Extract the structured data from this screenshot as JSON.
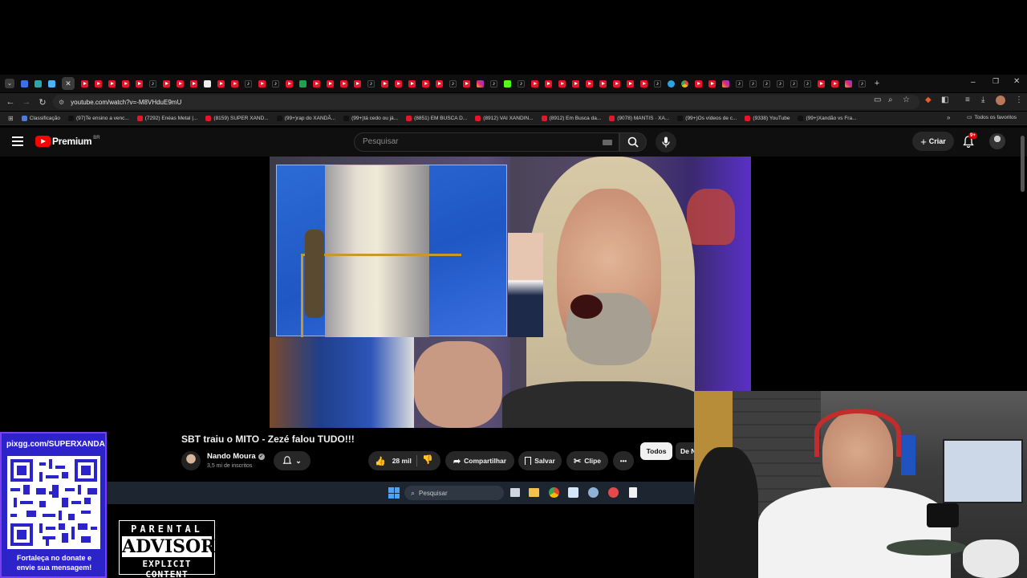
{
  "browser": {
    "url": "youtube.com/watch?v=-M8VHduE9mU",
    "bookmarks": [
      {
        "label": "Classificação",
        "color": "#4a7de0"
      },
      {
        "label": "(97)Te ensino a venc...",
        "color": "#111111"
      },
      {
        "label": "(7292) Enéas Metal |...",
        "color": "#e3162a"
      },
      {
        "label": "(8159) SUPER XAND...",
        "color": "#e3162a"
      },
      {
        "label": "(99+)rap do XANDÃ...",
        "color": "#111111"
      },
      {
        "label": "(99+)tá cedo ou já...",
        "color": "#111111"
      },
      {
        "label": "(8851) EM BUSCA D...",
        "color": "#e3162a"
      },
      {
        "label": "(8912) VAI XANDIN...",
        "color": "#e3162a"
      },
      {
        "label": "(8912) Em Busca da...",
        "color": "#e3162a"
      },
      {
        "label": "(9078) MANTIS · XA...",
        "color": "#e3162a"
      },
      {
        "label": "(99+)Os vídeos de c...",
        "color": "#111111"
      },
      {
        "label": "(9338) YouTube",
        "color": "#e3162a"
      },
      {
        "label": "(99+)Xandão vs Fra...",
        "color": "#111111"
      }
    ],
    "all_favorites_label": "Todos os favoritos"
  },
  "youtube": {
    "logo_text": "Premium",
    "logo_region": "BR",
    "search_placeholder": "Pesquisar",
    "create_label": "Criar",
    "notification_badge": "9+"
  },
  "video": {
    "title": "SBT traiu o MITO - Zezé falou TUDO!!!",
    "channel_name": "Nando Moura",
    "subscribers": "3,5 mi de inscritos",
    "likes": "28 mil",
    "share_label": "Compartilhar",
    "save_label": "Salvar",
    "clip_label": "Clipe",
    "more_label": "•••"
  },
  "chips": {
    "all": "Todos",
    "from": "De N"
  },
  "taskbar": {
    "search_placeholder": "Pesquisar"
  },
  "overlay": {
    "pix_url": "pixgg.com/SUPERXANDA",
    "pix_caption": "Fortaleça no donate e envie sua mensagem!",
    "advisory_top": "PARENTAL",
    "advisory_mid": "ADVISORY",
    "advisory_bottom": "EXPLICIT CONTENT"
  },
  "colors": {
    "youtube_red": "#ff0000",
    "pix_purple": "#2c23c8",
    "background": "#0f0f0f"
  }
}
